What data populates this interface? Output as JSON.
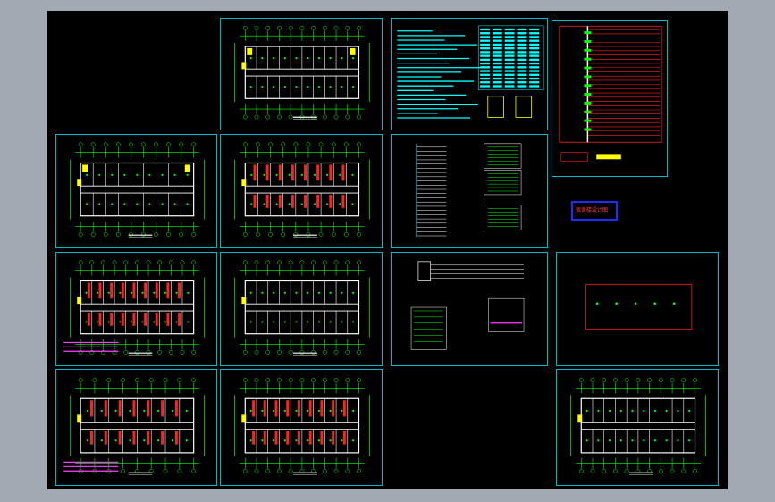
{
  "drawing": {
    "background": "#000000",
    "viewport_bg": "#a3a9b2",
    "frame_color": "#00b9c6",
    "colors": {
      "green": "#00ff00",
      "cyan": "#00ffff",
      "red": "#ff2020",
      "yellow": "#ffff00",
      "white": "#ffffff",
      "magenta": "#ff40ff",
      "blue": "#1d2cff"
    },
    "stamp_text": "宿舍楼设计图"
  },
  "sheets": [
    {
      "id": "s1",
      "kind": "plan",
      "cols": 10,
      "rows": 2,
      "accent": "yellow"
    },
    {
      "id": "s2",
      "kind": "notes"
    },
    {
      "id": "s3",
      "kind": "table"
    },
    {
      "id": "s4",
      "kind": "riser"
    },
    {
      "id": "s5",
      "kind": "plan",
      "cols": 9,
      "rows": 2,
      "accent": "yellow"
    },
    {
      "id": "s6",
      "kind": "plan",
      "cols": 9,
      "rows": 2,
      "accent": "red"
    },
    {
      "id": "s7",
      "kind": "system"
    },
    {
      "id": "s8",
      "kind": "plan",
      "cols": 10,
      "rows": 2,
      "accent": "red"
    },
    {
      "id": "s9",
      "kind": "plan",
      "cols": 10,
      "rows": 2,
      "accent": "green"
    },
    {
      "id": "s10",
      "kind": "schematic"
    },
    {
      "id": "s11",
      "kind": "plan",
      "cols": 8,
      "rows": 2,
      "accent": "red"
    },
    {
      "id": "s12",
      "kind": "plan",
      "cols": 10,
      "rows": 2,
      "accent": "red"
    },
    {
      "id": "s13",
      "kind": "plan",
      "cols": 10,
      "rows": 2,
      "accent": "green"
    },
    {
      "id": "s14",
      "kind": "plan",
      "cols": 7,
      "rows": 2,
      "accent": "red"
    }
  ]
}
